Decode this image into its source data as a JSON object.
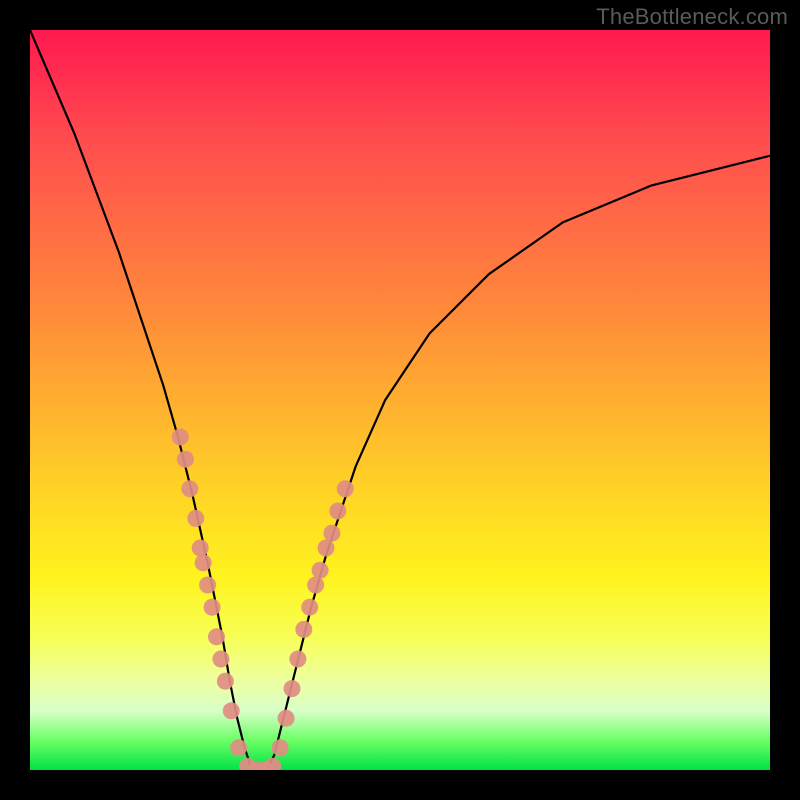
{
  "watermark": "TheBottleneck.com",
  "chart_data": {
    "type": "line",
    "title": "",
    "xlabel": "",
    "ylabel": "",
    "xlim": [
      0,
      100
    ],
    "ylim": [
      0,
      100
    ],
    "series": [
      {
        "name": "bottleneck-curve",
        "x": [
          0,
          3,
          6,
          9,
          12,
          15,
          18,
          20,
          22,
          24,
          26,
          27,
          28,
          29,
          30,
          31,
          32,
          33,
          34,
          36,
          38,
          40,
          44,
          48,
          54,
          62,
          72,
          84,
          100
        ],
        "y": [
          100,
          93,
          86,
          78,
          70,
          61,
          52,
          45,
          37,
          28,
          18,
          12,
          7,
          3,
          0,
          0,
          0,
          2,
          6,
          14,
          22,
          29,
          41,
          50,
          59,
          67,
          74,
          79,
          83
        ]
      }
    ],
    "scatter_points": {
      "name": "highlight-dots",
      "color": "#e08d83",
      "points": [
        {
          "x": 20.3,
          "y": 45
        },
        {
          "x": 21.0,
          "y": 42
        },
        {
          "x": 21.6,
          "y": 38
        },
        {
          "x": 22.4,
          "y": 34
        },
        {
          "x": 23.0,
          "y": 30
        },
        {
          "x": 23.4,
          "y": 28
        },
        {
          "x": 24.0,
          "y": 25
        },
        {
          "x": 24.6,
          "y": 22
        },
        {
          "x": 25.2,
          "y": 18
        },
        {
          "x": 25.8,
          "y": 15
        },
        {
          "x": 26.4,
          "y": 12
        },
        {
          "x": 27.2,
          "y": 8
        },
        {
          "x": 28.2,
          "y": 3
        },
        {
          "x": 29.4,
          "y": 0.5
        },
        {
          "x": 30.6,
          "y": 0
        },
        {
          "x": 31.8,
          "y": 0
        },
        {
          "x": 32.8,
          "y": 0.5
        },
        {
          "x": 33.8,
          "y": 3
        },
        {
          "x": 34.6,
          "y": 7
        },
        {
          "x": 35.4,
          "y": 11
        },
        {
          "x": 36.2,
          "y": 15
        },
        {
          "x": 37.0,
          "y": 19
        },
        {
          "x": 37.8,
          "y": 22
        },
        {
          "x": 38.6,
          "y": 25
        },
        {
          "x": 39.2,
          "y": 27
        },
        {
          "x": 40.0,
          "y": 30
        },
        {
          "x": 40.8,
          "y": 32
        },
        {
          "x": 41.6,
          "y": 35
        },
        {
          "x": 42.6,
          "y": 38
        }
      ]
    },
    "gradient_stops": [
      {
        "pos": 0,
        "color": "#ff1a4f"
      },
      {
        "pos": 50,
        "color": "#ffae30"
      },
      {
        "pos": 74,
        "color": "#fff31e"
      },
      {
        "pos": 100,
        "color": "#00e246"
      }
    ]
  }
}
